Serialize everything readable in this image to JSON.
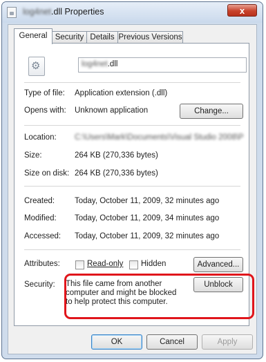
{
  "window": {
    "title_blurred": "log4net",
    "title_suffix": ".dll Properties",
    "close_label": "x"
  },
  "tabs": [
    {
      "label": "General"
    },
    {
      "label": "Security"
    },
    {
      "label": "Details"
    },
    {
      "label": "Previous Versions"
    }
  ],
  "general": {
    "file_name_blurred": "log4net",
    "file_name_ext": ".dll",
    "type_label": "Type of file:",
    "type_value": "Application extension (.dll)",
    "opens_label": "Opens with:",
    "opens_value": "Unknown application",
    "change_button": "Change...",
    "location_label": "Location:",
    "location_value": "C:\\Users\\Mark\\Documents\\Visual Studio 2008\\Pro",
    "size_label": "Size:",
    "size_value": "264 KB (270,336 bytes)",
    "size_disk_label": "Size on disk:",
    "size_disk_value": "264 KB (270,336 bytes)",
    "created_label": "Created:",
    "created_value": "Today, October 11, 2009, 32 minutes ago",
    "modified_label": "Modified:",
    "modified_value": "Today, October 11, 2009, 34 minutes ago",
    "accessed_label": "Accessed:",
    "accessed_value": "Today, October 11, 2009, 32 minutes ago",
    "attributes_label": "Attributes:",
    "readonly_label": "Read-only",
    "readonly_checked": false,
    "hidden_label": "Hidden",
    "hidden_checked": false,
    "advanced_button": "Advanced...",
    "security_label": "Security:",
    "security_text": "This file came from another computer and might be blocked to help protect this computer.",
    "unblock_button": "Unblock"
  },
  "footer": {
    "ok_button": "OK",
    "cancel_button": "Cancel",
    "apply_button": "Apply"
  },
  "colors": {
    "highlight": "#e0151b",
    "close_button": "#c8432c"
  }
}
